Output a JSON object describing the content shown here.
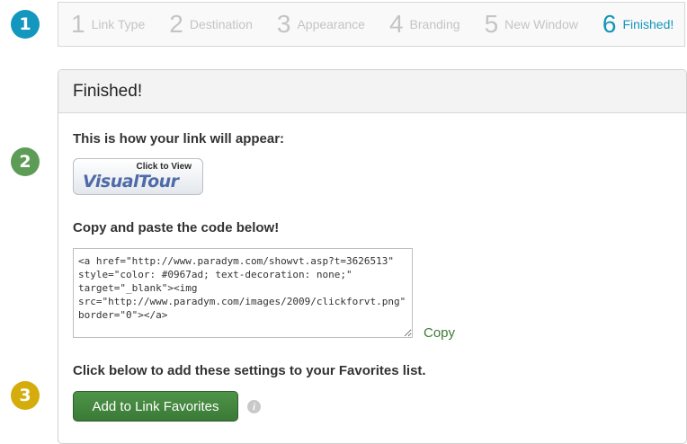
{
  "badges": [
    {
      "label": "1",
      "color": "#1497be"
    },
    {
      "label": "2",
      "color": "#5d9c57"
    },
    {
      "label": "3",
      "color": "#d4ad0c"
    }
  ],
  "wizard": {
    "steps": [
      {
        "num": "1",
        "label": "Link Type"
      },
      {
        "num": "2",
        "label": "Destination"
      },
      {
        "num": "3",
        "label": "Appearance"
      },
      {
        "num": "4",
        "label": "Branding"
      },
      {
        "num": "5",
        "label": "New Window"
      },
      {
        "num": "6",
        "label": "Finished!"
      }
    ],
    "active_step": 6,
    "active_color": "#1495b8"
  },
  "panel": {
    "title": "Finished!",
    "appearance_label": "This is how your link will appear:",
    "preview_button": {
      "top_text": "Click to View",
      "main_text": "VisualTour"
    },
    "copy_label": "Copy and paste the code below!",
    "code": "<a href=\"http://www.paradym.com/showvt.asp?t=3626513\" style=\"color: #0967ad; text-decoration: none;\" target=\"_blank\"><img src=\"http://www.paradym.com/images/2009/clickforvt.png\" border=\"0\"></a>",
    "copy_link": "Copy",
    "favorites_label": "Click below to add these settings to your Favorites list.",
    "favorites_button": "Add to Link Favorites",
    "info_icon": "info-icon"
  }
}
